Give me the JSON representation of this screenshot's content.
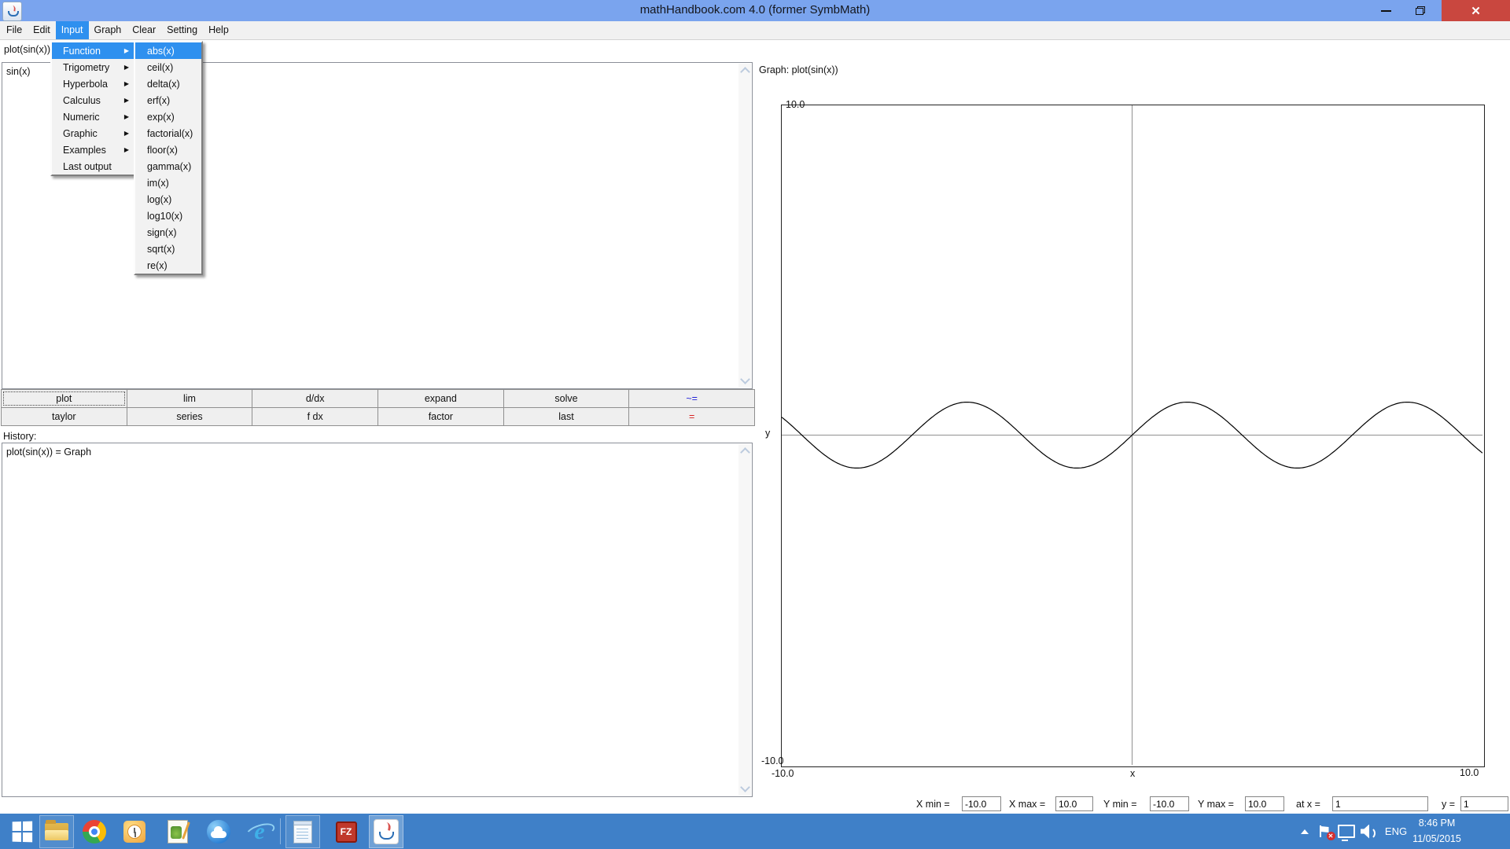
{
  "window": {
    "title": "mathHandbook.com 4.0 (former SymbMath)"
  },
  "icons": {
    "close_glyph": "✕",
    "submenu_arrow": "▶"
  },
  "menu_bar": {
    "items": [
      {
        "label": "File"
      },
      {
        "label": "Edit"
      },
      {
        "label": "Input"
      },
      {
        "label": "Graph"
      },
      {
        "label": "Clear"
      },
      {
        "label": "Setting"
      },
      {
        "label": "Help"
      }
    ]
  },
  "menus": {
    "input_menu": {
      "items": [
        {
          "label": "Function"
        },
        {
          "label": "Trigometry"
        },
        {
          "label": "Hyperbola"
        },
        {
          "label": "Calculus"
        },
        {
          "label": "Numeric"
        },
        {
          "label": "Graphic"
        },
        {
          "label": "Examples"
        },
        {
          "label": "Last output"
        }
      ]
    },
    "function_submenu": {
      "items": [
        {
          "label": "abs(x)"
        },
        {
          "label": "ceil(x)"
        },
        {
          "label": "delta(x)"
        },
        {
          "label": "erf(x)"
        },
        {
          "label": "exp(x)"
        },
        {
          "label": "factorial(x)"
        },
        {
          "label": "floor(x)"
        },
        {
          "label": "gamma(x)"
        },
        {
          "label": "im(x)"
        },
        {
          "label": "log(x)"
        },
        {
          "label": "log10(x)"
        },
        {
          "label": "sign(x)"
        },
        {
          "label": "sqrt(x)"
        },
        {
          "label": "re(x)"
        }
      ]
    }
  },
  "left_panel": {
    "input_label": "plot(sin(x)) =",
    "editor_text": "sin(x)",
    "buttons": [
      {
        "label": "plot"
      },
      {
        "label": "lim"
      },
      {
        "label": "d/dx"
      },
      {
        "label": "expand"
      },
      {
        "label": "solve"
      },
      {
        "label": "~=",
        "color": "#1f1fd8"
      },
      {
        "label": "taylor"
      },
      {
        "label": "series"
      },
      {
        "label": "f dx"
      },
      {
        "label": "factor"
      },
      {
        "label": "last"
      },
      {
        "label": "=",
        "color": "#d81f1f"
      }
    ],
    "history_label": "History:",
    "history_text": "plot(sin(x)) = Graph"
  },
  "graph_panel": {
    "title": "Graph: plot(sin(x))",
    "labels": {
      "y_max": "10.0",
      "y_min": "-10.0",
      "x_min": "-10.0",
      "x_max": "10.0",
      "x_axis": "x",
      "y_axis": "y"
    },
    "controls": [
      {
        "label": "X min =",
        "value": "-10.0"
      },
      {
        "label": "X max =",
        "value": "10.0"
      },
      {
        "label": "Y min =",
        "value": "-10.0"
      },
      {
        "label": "Y max =",
        "value": "10.0"
      },
      {
        "label": "at x =",
        "value": "1"
      },
      {
        "label": "y =",
        "value": "1"
      }
    ]
  },
  "chart_data": {
    "type": "line",
    "title": "Graph: plot(sin(x))",
    "function": "sin(x)",
    "xlabel": "x",
    "ylabel": "y",
    "xlim": [
      -10,
      10
    ],
    "ylim": [
      -10,
      10
    ],
    "grid": false,
    "curve_color": "#000000",
    "axis_color": "#909090",
    "x_samples": [
      -10,
      -9,
      -8,
      -7,
      -6,
      -5,
      -4,
      -3,
      -2,
      -1,
      0,
      1,
      2,
      3,
      4,
      5,
      6,
      7,
      8,
      9,
      10
    ],
    "y_samples": [
      0.544,
      -0.412,
      -0.989,
      -0.657,
      0.279,
      0.959,
      0.757,
      -0.141,
      -0.909,
      -0.841,
      0,
      0.841,
      0.909,
      0.141,
      -0.757,
      -0.959,
      -0.279,
      0.657,
      0.989,
      0.412,
      -0.544
    ]
  },
  "taskbar": {
    "filezilla_label": "FZ",
    "tray": {
      "language": "ENG",
      "time": "8:46 PM",
      "date": "11/05/2015"
    }
  }
}
